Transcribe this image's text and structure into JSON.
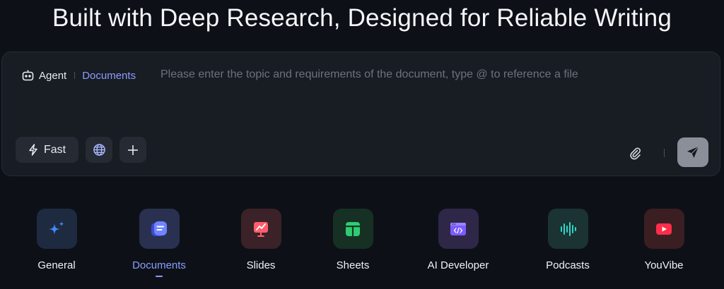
{
  "headline": "Built with Deep Research, Designed for Reliable Writing",
  "composer": {
    "agent_label": "Agent",
    "mode_label": "Documents",
    "placeholder": "Please enter the topic and requirements of the document, type @ to reference a file",
    "value": "",
    "fast_label": "Fast"
  },
  "categories": [
    {
      "label": "General"
    },
    {
      "label": "Documents",
      "active": true
    },
    {
      "label": "Slides"
    },
    {
      "label": "Sheets"
    },
    {
      "label": "AI Developer"
    },
    {
      "label": "Podcasts"
    },
    {
      "label": "YouVibe"
    }
  ],
  "colors": {
    "accent": "#8b9dff",
    "background": "#0d1117",
    "panel": "#181c23",
    "placeholder": "#6c727d"
  },
  "icons": {
    "agent": "robot-icon",
    "fast": "lightning-icon",
    "web": "globe-icon",
    "add": "plus-icon",
    "attach": "paperclip-icon",
    "send": "paper-plane-icon"
  }
}
